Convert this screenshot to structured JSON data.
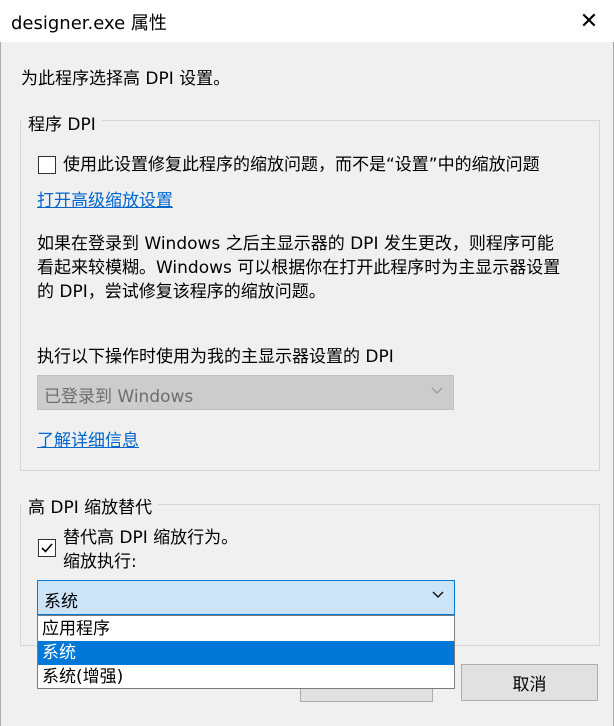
{
  "window": {
    "title": "designer.exe 属性",
    "close_glyph": "✕"
  },
  "intro": "为此程序选择高 DPI 设置。",
  "program_dpi": {
    "legend": "程序 DPI",
    "checkbox_label": "使用此设置修复此程序的缩放问题，而不是“设置”中的缩放问题",
    "checkbox_checked": false,
    "advanced_link": "打开高级缩放设置",
    "description": [
      "如果在登录到 Windows 之后主显示器的 DPI 发生更改，则程序可能",
      "看起来较模糊。Windows 可以根据你在打开此程序时为主显示器设置",
      "的 DPI，尝试修复该程序的缩放问题。"
    ],
    "combo_label": "执行以下操作时使用为我的主显示器设置的 DPI",
    "combo_value": "已登录到 Windows",
    "learn_more_link": "了解详细信息"
  },
  "high_dpi": {
    "legend": "高 DPI 缩放替代",
    "checkbox_label": "替代高 DPI 缩放行为。",
    "checkbox_checked": true,
    "sublabel": "缩放执行:",
    "combo_value": "系统",
    "options": [
      "应用程序",
      "系统",
      "系统(增强)"
    ],
    "selected_index": 1
  },
  "buttons": {
    "cancel": "取消"
  },
  "colors": {
    "accent": "#0078d7",
    "link": "#0066cc",
    "dialog_bg": "#f0f0f0"
  }
}
